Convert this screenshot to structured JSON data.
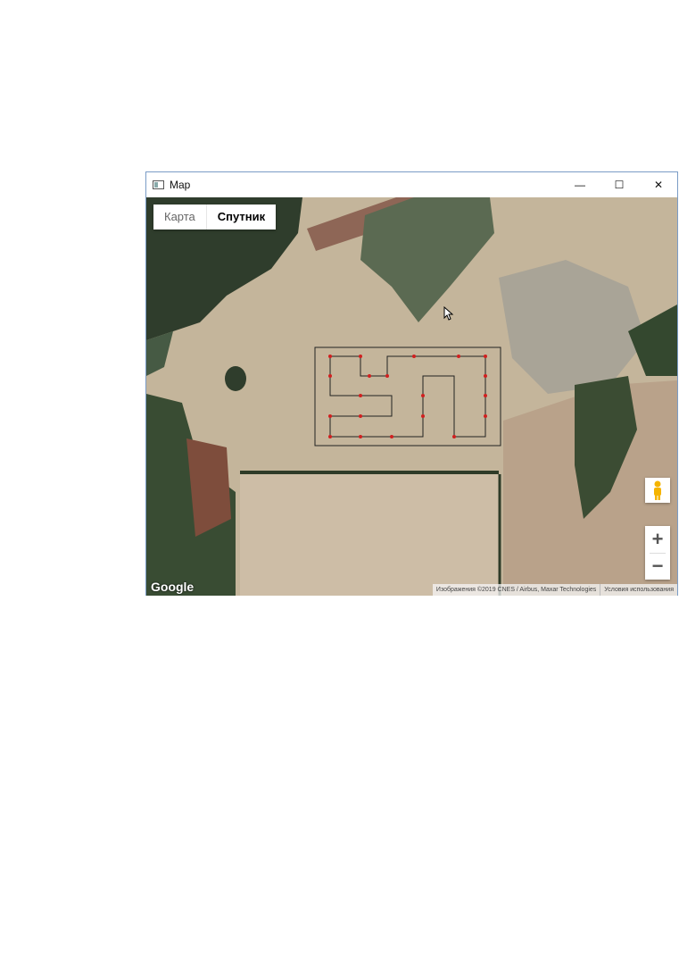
{
  "window": {
    "title": "Map",
    "minimize_glyph": "—",
    "maximize_glyph": "☐",
    "close_glyph": "✕"
  },
  "map": {
    "map_type_buttons": {
      "map_label": "Карта",
      "satellite_label": "Спутник",
      "selected": "Спутник"
    },
    "logo": "Google",
    "attribution": "Изображения ©2019 CNES / Airbus, Maxar Technologies",
    "terms_link": "Условия использования",
    "zoom_in_label": "+",
    "zoom_out_label": "−",
    "pegman_icon": "street-view-pegman-icon",
    "colors": {
      "field": "#c7b598",
      "forest": "#2e3b28",
      "plowed": "#8b5e4c",
      "route_arrow": "#d02020",
      "route_line": "#222222"
    }
  }
}
